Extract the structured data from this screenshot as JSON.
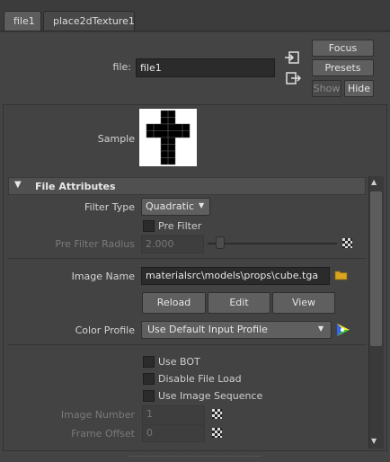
{
  "tabs": [
    {
      "label": "file1"
    },
    {
      "label": "place2dTexture1"
    }
  ],
  "node": {
    "label": "file:",
    "value": "file1"
  },
  "buttons": {
    "focus": "Focus",
    "presets": "Presets",
    "show": "Show",
    "hide": "Hide"
  },
  "sample": {
    "label": "Sample"
  },
  "section": {
    "title": "File Attributes"
  },
  "filter": {
    "type_label": "Filter Type",
    "type_value": "Quadratic",
    "prefilter_label": "Pre Filter",
    "radius_label": "Pre Filter Radius",
    "radius_value": "2.000",
    "radius_slider_fraction": 0.1
  },
  "image": {
    "name_label": "Image Name",
    "name_value": "materialsrc\\models\\props\\cube.tga",
    "reload": "Reload",
    "edit": "Edit",
    "view": "View",
    "profile_label": "Color Profile",
    "profile_value": "Use Default Input Profile"
  },
  "options": {
    "use_bot": "Use BOT",
    "disable_load": "Disable File Load",
    "use_sequence": "Use Image Sequence",
    "image_number_label": "Image Number",
    "image_number_value": "1",
    "frame_offset_label": "Frame Offset",
    "frame_offset_value": "0"
  },
  "icons": {
    "input": "input-connection-icon",
    "output": "output-connection-icon",
    "folder": "folder-icon",
    "color_wheel": "color-wheel-icon",
    "checker": "checker-icon"
  }
}
